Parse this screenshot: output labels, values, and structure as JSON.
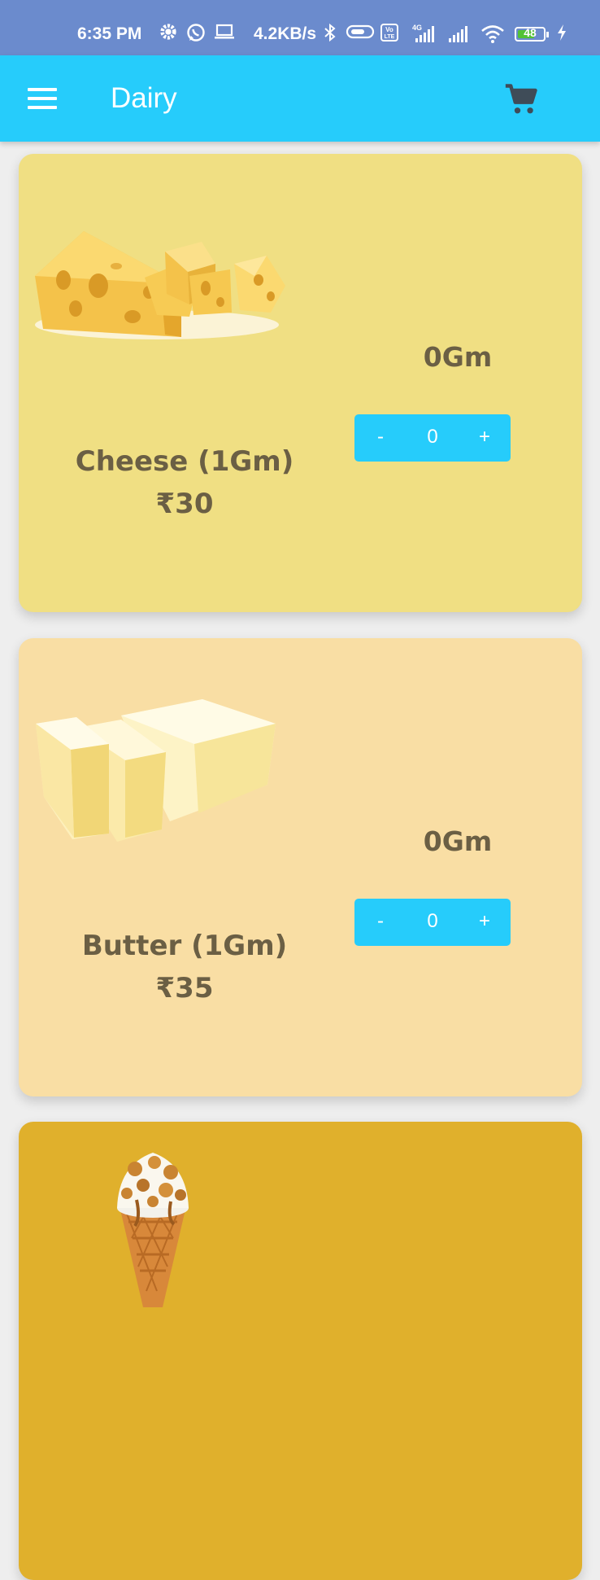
{
  "status_bar": {
    "time": "6:35 PM",
    "net_speed": "4.2KB/s",
    "network": "4G",
    "volte": "Vo LTE",
    "battery": "48",
    "icons": [
      "gear-icon",
      "whatsapp-icon",
      "laptop-icon",
      "bluetooth-icon",
      "toggle-icon",
      "volte-icon",
      "signal-icon",
      "signal-icon",
      "wifi-icon",
      "battery-icon",
      "charging-icon"
    ]
  },
  "app_bar": {
    "title": "Dairy",
    "menu_icon": "hamburger-menu-icon",
    "cart_icon": "shopping-cart-icon"
  },
  "colors": {
    "accent": "#26ccfb",
    "status_bar": "#6b8bcd",
    "text": "#6b5f44"
  },
  "products": [
    {
      "name": "Cheese (1Gm)",
      "price": "₹30",
      "quantity_total": "0Gm",
      "stepper": {
        "minus": "-",
        "value": "0",
        "plus": "+"
      },
      "card_color": "#f0df83",
      "image": "cheese-image"
    },
    {
      "name": "Butter (1Gm)",
      "price": "₹35",
      "quantity_total": "0Gm",
      "stepper": {
        "minus": "-",
        "value": "0",
        "plus": "+"
      },
      "card_color": "#f9dea4",
      "image": "butter-image"
    },
    {
      "card_color": "#e0b02c",
      "image": "ice-cream-cone-image"
    }
  ]
}
